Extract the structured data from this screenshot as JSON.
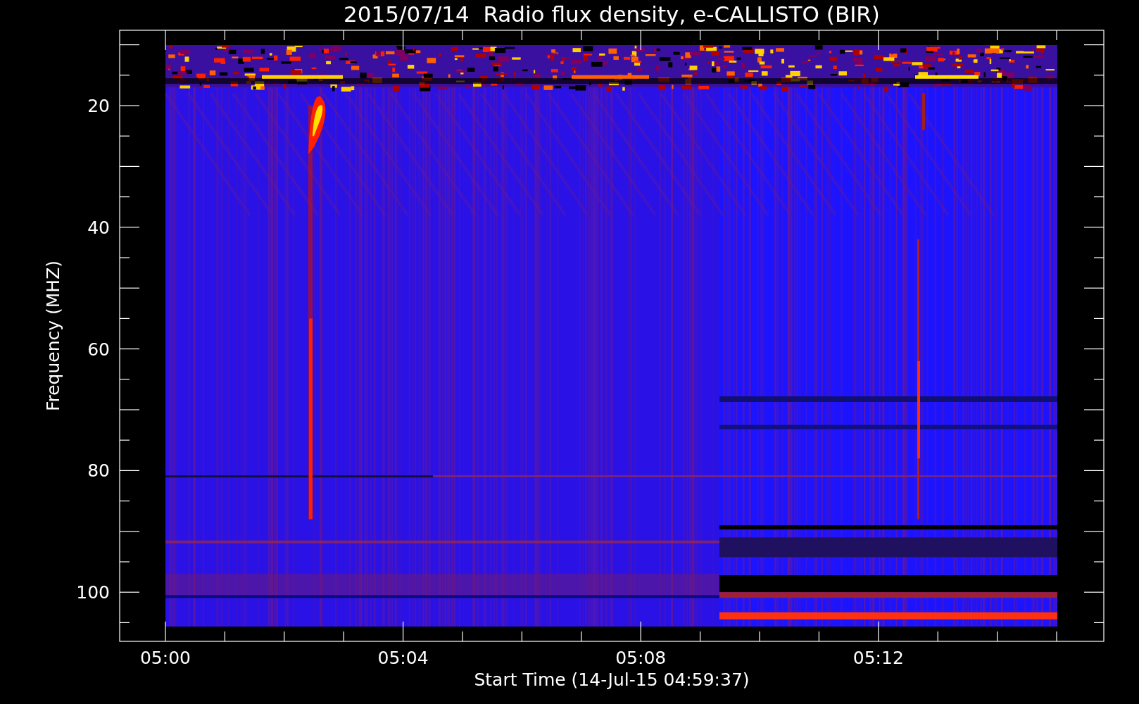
{
  "title": "2015/07/14  Radio flux density, e-CALLISTO (BIR)",
  "ylabel": "Frequency (MHZ)",
  "xlabel": "Start Time (14-Jul-15 04:59:37)",
  "yticks": [
    "20",
    "40",
    "60",
    "80",
    "100"
  ],
  "xticks": [
    "05:00",
    "05:04",
    "05:08",
    "05:12"
  ]
}
